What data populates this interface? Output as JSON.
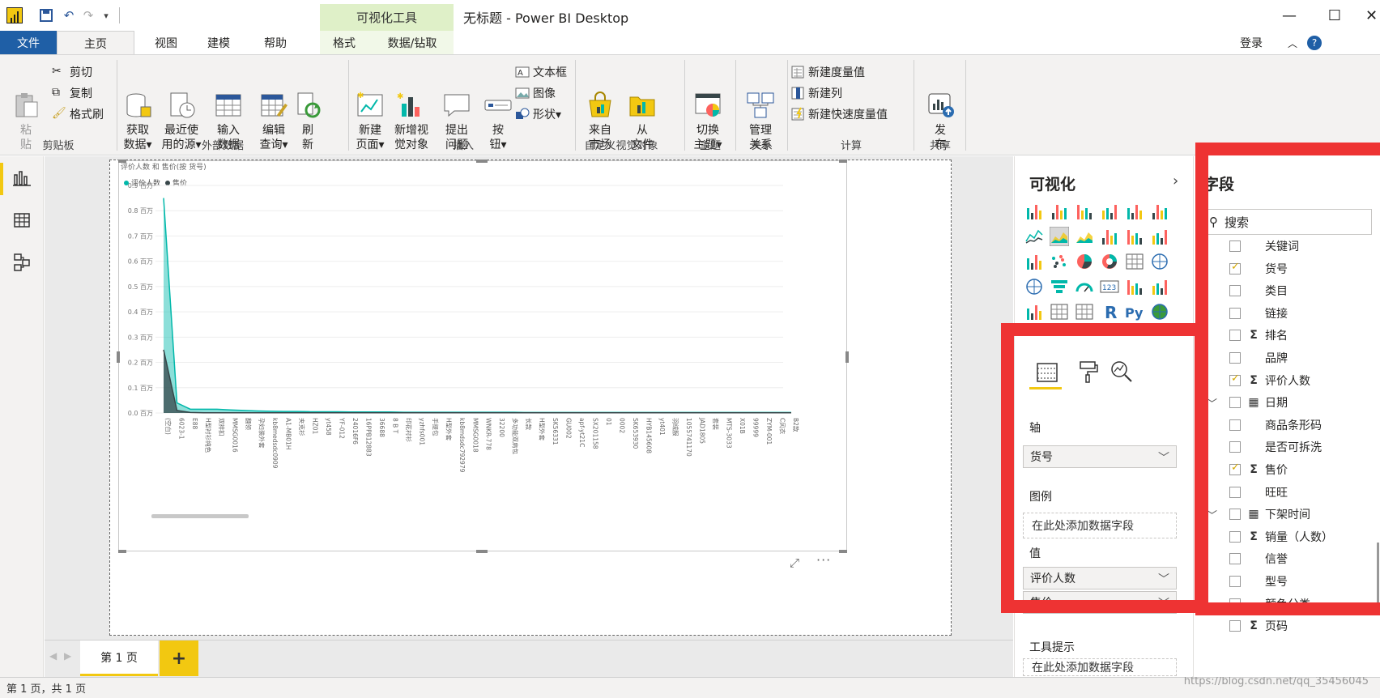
{
  "window": {
    "title": "无标题 - Power BI Desktop",
    "contextual_group": "可视化工具",
    "signin": "登录"
  },
  "tabs": {
    "file": "文件",
    "home": "主页",
    "view": "视图",
    "modeling": "建模",
    "help": "帮助",
    "format": "格式",
    "data_drill": "数据/钻取"
  },
  "ribbon": {
    "clipboard": {
      "label": "剪贴板",
      "paste": "粘\n贴",
      "cut": "剪切",
      "copy": "复制",
      "format_painter": "格式刷"
    },
    "external_data": {
      "label": "外部数据",
      "get_data": "获取\n数据▾",
      "recent_sources": "最近使\n用的源▾",
      "enter_data": "输入\n数据",
      "edit_queries": "编辑\n查询▾",
      "refresh": "刷\n新"
    },
    "insert": {
      "label": "插入",
      "new_page": "新建\n页面▾",
      "new_visual": "新增视\n觉对象",
      "ask_question": "提出\n问题",
      "buttons": "按\n钮▾",
      "textbox": "文本框",
      "image": "图像",
      "shapes": "形状▾"
    },
    "custom_visuals": {
      "label": "自定义视觉对象",
      "marketplace": "来自\n市场",
      "from_file": "从\n文件"
    },
    "themes": {
      "label": "主题",
      "switch_theme": "切换\n主题▾"
    },
    "relationships": {
      "label": "关系",
      "manage": "管理\n关系"
    },
    "calculations": {
      "label": "计算",
      "new_measure": "新建度量值",
      "new_column": "新建列",
      "new_quick_measure": "新建快速度量值"
    },
    "share": {
      "label": "共享",
      "publish": "发\n布"
    }
  },
  "chart_data": {
    "type": "line",
    "title": "评价人数 和 售价(按 货号)",
    "legend_position": "top-left",
    "ylim": [
      0,
      0.9
    ],
    "yticks": [
      "0.0 百万",
      "0.1 百万",
      "0.2 百万",
      "0.3 百万",
      "0.4 百万",
      "0.5 百万",
      "0.6 百万",
      "0.7 百万",
      "0.8 百万",
      "0.9 百万"
    ],
    "categories": [
      "(空白)",
      "6023-1",
      "E88",
      "H型衬衫纯色",
      "双排扣",
      "MMSG0016",
      "翻领",
      "孕妇装外套",
      "kb8medsdc0909",
      "A1-MB01H",
      "夹克衫",
      "HZ01",
      "yt458",
      "YF-012",
      "24016F6",
      "16PPB12883",
      "36688",
      "8 B T",
      "印花衬衫",
      "yzhfs001",
      "手提包",
      "H型外套",
      "kb8mdsdc792979",
      "MMSG0018",
      "WNKR-778",
      "32200",
      "多功能双肩包",
      "长款",
      "H型外套",
      "SK56331",
      "GU002",
      "apf-yt21C",
      "SX201158",
      "01",
      "0002",
      "SK653930",
      "HYB145608",
      "yt401",
      "羽绒服",
      "1055741170",
      "JAD1805",
      "套装",
      "MTS-3033",
      "X01B",
      "99999",
      "ZYM-001",
      "C风衣",
      "B2款"
    ],
    "series": [
      {
        "name": "评价人数",
        "color": "#01b8aa",
        "values": [
          0.85,
          0.04,
          0.015,
          0.015,
          0.015,
          0.012,
          0.01,
          0.008,
          0.007,
          0.006,
          0.006,
          0.005,
          0.005,
          0.005,
          0.004,
          0.004,
          0.004,
          0.004,
          0.003,
          0.003,
          0.003,
          0.003,
          0.003,
          0.003,
          0.003,
          0.003,
          0.003,
          0.002,
          0.002,
          0.002,
          0.002,
          0.002,
          0.002,
          0.002,
          0.002,
          0.002,
          0.002,
          0.002,
          0.002,
          0.002,
          0.002,
          0.002,
          0.002,
          0.002,
          0.002,
          0.002,
          0.002,
          0.002
        ]
      },
      {
        "name": "售价",
        "color": "#374649",
        "values": [
          0.25,
          0.01,
          0.002,
          0.001,
          0.001,
          0.001,
          0.001,
          0.001,
          0.001,
          0.001,
          0.001,
          0.001,
          0.001,
          0.001,
          0.001,
          0.001,
          0.001,
          0.001,
          0.001,
          0.001,
          0.001,
          0.001,
          0.001,
          0.001,
          0.001,
          0.001,
          0.001,
          0.001,
          0.001,
          0.001,
          0.001,
          0.001,
          0.001,
          0.001,
          0.001,
          0.001,
          0.001,
          0.001,
          0.001,
          0.001,
          0.001,
          0.001,
          0.001,
          0.001,
          0.001,
          0.001,
          0.001,
          0.001
        ]
      }
    ]
  },
  "pages": {
    "tab1": "第 1 页",
    "add": "+"
  },
  "status": {
    "text": "第 1 页，共 1 页",
    "watermark": "https://blog.csdn.net/qq_35456045"
  },
  "viz_pane": {
    "title": "可视化",
    "more": "···",
    "axis_label": "轴",
    "axis_field": "货号",
    "legend_label": "图例",
    "legend_placeholder": "在此处添加数据字段",
    "values_label": "值",
    "value1": "评价人数",
    "value2": "售价",
    "tooltip_label": "工具提示",
    "tooltip_placeholder": "在此处添加数据字段"
  },
  "fields_pane": {
    "title": "字段",
    "search_placeholder": "搜索",
    "fields": [
      {
        "label": "关键词",
        "checked": false,
        "sigma": false,
        "table": false,
        "expand": false
      },
      {
        "label": "货号",
        "checked": true,
        "sigma": false,
        "table": false,
        "expand": false
      },
      {
        "label": "类目",
        "checked": false,
        "sigma": false,
        "table": false,
        "expand": false
      },
      {
        "label": "链接",
        "checked": false,
        "sigma": false,
        "table": false,
        "expand": false
      },
      {
        "label": "排名",
        "checked": false,
        "sigma": true,
        "table": false,
        "expand": false
      },
      {
        "label": "品牌",
        "checked": false,
        "sigma": false,
        "table": false,
        "expand": false
      },
      {
        "label": "评价人数",
        "checked": true,
        "sigma": true,
        "table": false,
        "expand": false
      },
      {
        "label": "日期",
        "checked": false,
        "sigma": false,
        "table": true,
        "expand": true
      },
      {
        "label": "商品条形码",
        "checked": false,
        "sigma": false,
        "table": false,
        "expand": false
      },
      {
        "label": "是否可拆洗",
        "checked": false,
        "sigma": false,
        "table": false,
        "expand": false
      },
      {
        "label": "售价",
        "checked": true,
        "sigma": true,
        "table": false,
        "expand": false
      },
      {
        "label": "旺旺",
        "checked": false,
        "sigma": false,
        "table": false,
        "expand": false
      },
      {
        "label": "下架时间",
        "checked": false,
        "sigma": false,
        "table": true,
        "expand": true
      },
      {
        "label": "销量（人数）",
        "checked": false,
        "sigma": true,
        "table": false,
        "expand": false
      },
      {
        "label": "信誉",
        "checked": false,
        "sigma": false,
        "table": false,
        "expand": false
      },
      {
        "label": "型号",
        "checked": false,
        "sigma": false,
        "table": false,
        "expand": false
      },
      {
        "label": "颜色分类",
        "checked": false,
        "sigma": false,
        "table": false,
        "expand": false
      },
      {
        "label": "页码",
        "checked": false,
        "sigma": true,
        "table": false,
        "expand": false
      }
    ]
  },
  "colors": {
    "accent_yellow": "#f2c811",
    "file_tab": "#1f5fa6",
    "highlight_red": "#ee3333",
    "series_teal": "#01b8aa",
    "series_dark": "#374649"
  }
}
